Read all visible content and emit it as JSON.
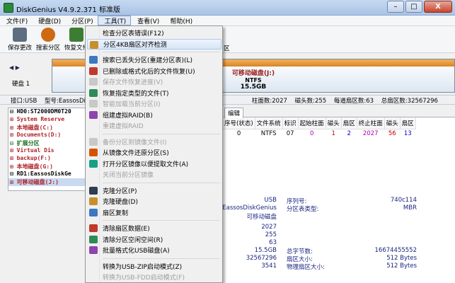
{
  "window": {
    "title": "DiskGenius V4.9.2.371 标准版",
    "min": "–",
    "max": "□",
    "close": "X"
  },
  "menubar": [
    "文件(F)",
    "硬盘(D)",
    "分区(P)",
    "工具(T)",
    "查看(V)",
    "帮助(H)"
  ],
  "toolbar": [
    {
      "label": "保存更改",
      "icon": "save-icon",
      "color": "#5e6e80"
    },
    {
      "label": "搜索分区",
      "icon": "search-icon",
      "color": "#ce6a12"
    },
    {
      "label": "恢复文件",
      "icon": "recover-icon",
      "color": "#3d7d33"
    }
  ],
  "diskbar": {
    "nav": "◀ ▶",
    "disk_label": "硬盘 1",
    "partition_name": "可移动磁盘(J:)",
    "fs": "NTFS",
    "size": "15.5GB",
    "dropdown_arrow": "▼",
    "fragment": "区"
  },
  "infobar": [
    "接口:USB",
    "型号:EassosDisk",
    "柱面数:2027",
    "磁头数:255",
    "每道扇区数:63",
    "总扇区数:32567296"
  ],
  "tree": [
    {
      "text": "⊟ HD0:ST2000DM0T20",
      "cls": "disk"
    },
    {
      "text": "  ⊞ System Reserve",
      "cls": "red"
    },
    {
      "text": "  ⊞ 本地磁盘(C:)",
      "cls": "red"
    },
    {
      "text": "  ⊞ Documents(D:)",
      "cls": "red"
    },
    {
      "text": "  ⊟ 扩展分区",
      "cls": "dkgreen"
    },
    {
      "text": "    ⊞ Virtual Dis",
      "cls": "red"
    },
    {
      "text": "    ⊞ backup(F:)",
      "cls": "red"
    },
    {
      "text": "    ⊞ 本地磁盘(G:)",
      "cls": "red"
    },
    {
      "text": "⊟ RD1:EassosDiskGe",
      "cls": "disk"
    },
    {
      "text": "  ⊞ 可移动磁盘(J:)",
      "cls": "red sel"
    }
  ],
  "tabs": [
    "编辑"
  ],
  "partition_table": {
    "headers": [
      "序号(状态)",
      "文件系统",
      "标识",
      "起始柱面",
      "磁头",
      "扇区",
      "终止柱面",
      "磁头",
      "扇区"
    ],
    "rows": [
      [
        "0",
        "NTFS",
        "07",
        "0",
        "1",
        "2",
        "2027",
        "56",
        "13"
      ]
    ]
  },
  "details": {
    "left_values": [
      "USB",
      "EassosDiskGenius",
      "可移动磁盘"
    ],
    "right_labels": [
      "序列号:",
      "分区表类型:"
    ],
    "right_values": [
      "740c114",
      "MBR"
    ],
    "numbers": [
      "2027",
      "255",
      "63",
      "15.5GB",
      "32567296",
      "3541"
    ],
    "labels2": [
      "总字节数:",
      "扇区大小:",
      "物理扇区大小:"
    ],
    "values2": [
      "16674455552",
      "512 Bytes",
      "512 Bytes"
    ]
  },
  "tools_menu": [
    {
      "label": "检查分区表错误(F12)",
      "icon": "",
      "disabled": false,
      "hl": false
    },
    {
      "label": "分区4KB扇区对齐检测",
      "icon": "align-icon",
      "disabled": false,
      "hl": true
    },
    {
      "sep": true
    },
    {
      "label": "搜索已丢失分区(重建分区表)(L)",
      "icon": "search-partition-icon",
      "disabled": false,
      "hl": false
    },
    {
      "label": "已删除或格式化后的文件恢复(U)",
      "icon": "recover-file-icon",
      "disabled": false,
      "hl": false
    },
    {
      "label": "保存文件恢复进度(V)",
      "icon": "save-progress-icon",
      "disabled": true,
      "hl": false
    },
    {
      "label": "恢复指定类型的文件(T)",
      "icon": "file-type-icon",
      "disabled": false,
      "hl": false
    },
    {
      "label": "智能加载当前分区(I)",
      "icon": "smart-load-icon",
      "disabled": true,
      "hl": false
    },
    {
      "label": "组建虚拟RAID(B)",
      "icon": "raid-icon",
      "disabled": false,
      "hl": false
    },
    {
      "label": "重建虚拟RAID",
      "icon": "",
      "disabled": true,
      "hl": false
    },
    {
      "sep": true
    },
    {
      "label": "备份分区到镜像文件(I)",
      "icon": "backup-icon",
      "disabled": true,
      "hl": false
    },
    {
      "label": "从镜像文件还原分区(S)",
      "icon": "restore-icon",
      "disabled": false,
      "hl": false
    },
    {
      "label": "打开分区镜像以便提取文件(A)",
      "icon": "open-image-icon",
      "disabled": false,
      "hl": false
    },
    {
      "label": "关闭当前分区镜像",
      "icon": "",
      "disabled": true,
      "hl": false
    },
    {
      "sep": true
    },
    {
      "label": "克隆分区(P)",
      "icon": "clone-partition-icon",
      "disabled": false,
      "hl": false
    },
    {
      "label": "克隆硬盘(D)",
      "icon": "clone-disk-icon",
      "disabled": false,
      "hl": false
    },
    {
      "label": "扇区复制",
      "icon": "sector-copy-icon",
      "disabled": false,
      "hl": false
    },
    {
      "sep": true
    },
    {
      "label": "清除扇区数据(E)",
      "icon": "clear-sector-icon",
      "disabled": false,
      "hl": false
    },
    {
      "label": "清除分区空闲空间(R)",
      "icon": "clear-free-icon",
      "disabled": false,
      "hl": false
    },
    {
      "label": "批量格式化USB磁盘(A)",
      "icon": "usb-format-icon",
      "disabled": false,
      "hl": false
    },
    {
      "sep": true
    },
    {
      "label": "转换为USB-ZIP启动模式(Z)",
      "icon": "",
      "disabled": false,
      "hl": false
    },
    {
      "label": "转换为USB-FDD启动模式(F)",
      "icon": "",
      "disabled": true,
      "hl": false
    }
  ]
}
